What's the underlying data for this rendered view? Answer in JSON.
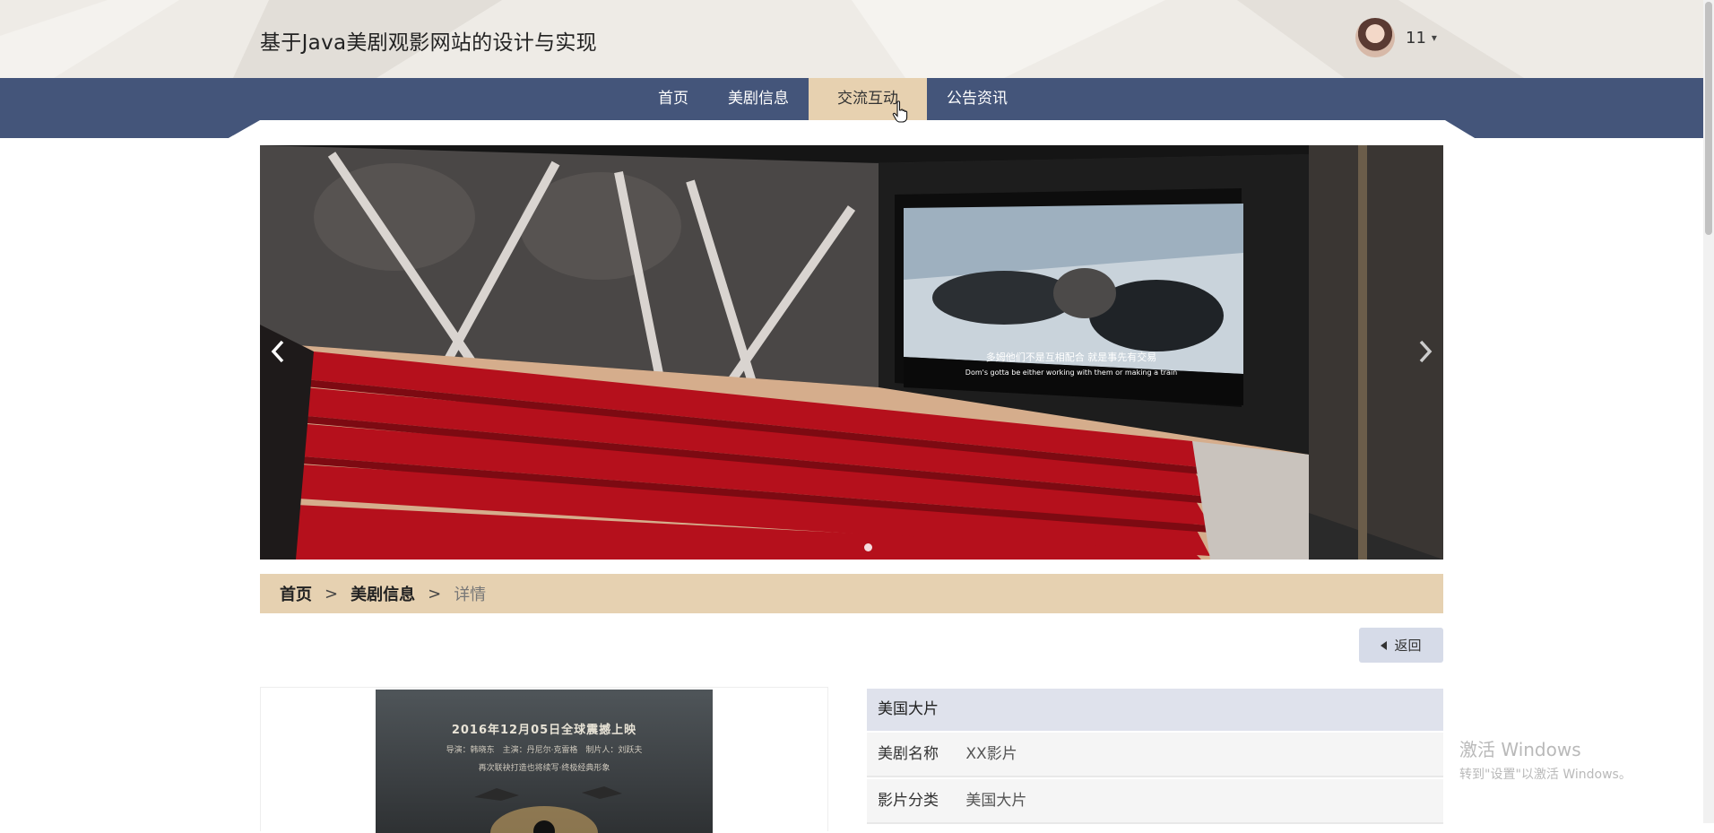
{
  "header": {
    "title": "基于Java美剧观影网站的设计与实现",
    "user": {
      "name": "11",
      "avatar_icon": "avatar-icon",
      "caret": "▾"
    }
  },
  "nav": {
    "items": [
      {
        "label": "首页",
        "active": false
      },
      {
        "label": "美剧信息",
        "active": false
      },
      {
        "label": "交流互动",
        "active": true
      },
      {
        "label": "公告资讯",
        "active": false
      }
    ],
    "bar_color": "#44557a",
    "active_color": "#e7d1b0"
  },
  "banner": {
    "subtitle_cn": "多姆他们不是互相配合 就是事先有交易",
    "subtitle_en": "Dom's gotta be either working with them or making a train",
    "prev_icon": "chevron-left-icon",
    "next_icon": "chevron-right-icon"
  },
  "breadcrumb": {
    "home": "首页",
    "sep": ">",
    "parent": "美剧信息",
    "current": "详情"
  },
  "back_button": {
    "label": "返回"
  },
  "poster": {
    "line1": "2016年12月05日全球震撼上映",
    "line2": "导演：韩晓东　主演：丹尼尔·克雷格　制片人：刘跃夫",
    "line3": "再次联袂打造也将续写·终极经典形象"
  },
  "info": {
    "header": "美国大片",
    "rows": [
      {
        "label": "美剧名称",
        "value": "XX影片"
      },
      {
        "label": "影片分类",
        "value": "美国大片"
      }
    ]
  },
  "watermark": {
    "line1": "激活 Windows",
    "line2": "转到\"设置\"以激活 Windows。"
  }
}
